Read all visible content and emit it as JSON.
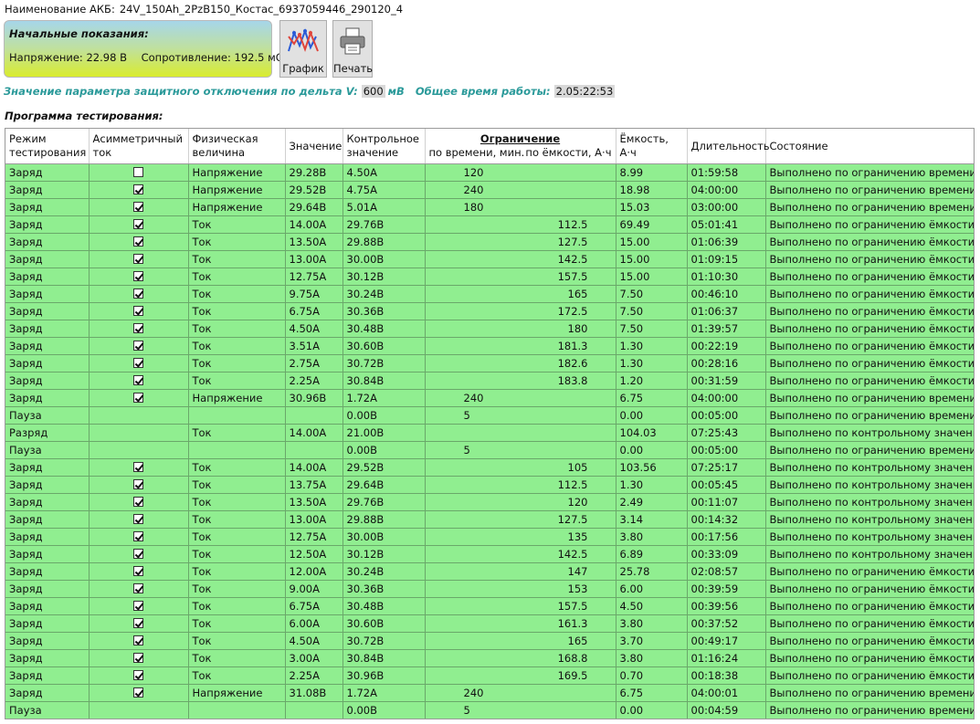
{
  "header": {
    "battery_label": "Наименование АКБ:",
    "battery_name": "24V_150Ah_2PzB150_Костас_6937059446_290120_4"
  },
  "initial": {
    "title": "Начальные показания:",
    "voltage_label": "Напряжение:",
    "voltage_value": "22.98",
    "voltage_unit": "В",
    "resistance_label": "Сопротивление:",
    "resistance_value": "192.5",
    "resistance_unit": "мОм"
  },
  "toolbar": {
    "chart_label": "График",
    "print_label": "Печать"
  },
  "protection": {
    "label": "Значение параметра защитного отключения по дельта V:",
    "value": "600",
    "unit": "мВ",
    "runtime_label": "Общее время работы:",
    "runtime_value": "2.05:22:53"
  },
  "program_title": "Программа тестирования:",
  "columns": {
    "mode": "Режим тестирования",
    "asym": "Асимметричный ток",
    "phys": "Физическая величина",
    "value": "Значение",
    "control": "Контрольное значение",
    "limit": "Ограничение",
    "limit_time": "по времени, мин.",
    "limit_cap": "по ёмкости, А·ч",
    "capacity": "Ёмкость, А·ч",
    "duration": "Длительность",
    "state": "Состояние"
  },
  "colors": {
    "row_bg": "#90ee90",
    "accent": "#2b9a9a"
  },
  "rows": [
    {
      "mode": "Заряд",
      "asym": "unchecked",
      "phys": "Напряжение",
      "value": "29.28В",
      "control": "4.50А",
      "lt": "120",
      "lc": "",
      "cap": "8.99",
      "dur": "01:59:58",
      "state": "Выполнено по ограничению времени"
    },
    {
      "mode": "Заряд",
      "asym": "checked",
      "phys": "Напряжение",
      "value": "29.52В",
      "control": "4.75А",
      "lt": "240",
      "lc": "",
      "cap": "18.98",
      "dur": "04:00:00",
      "state": "Выполнено по ограничению времени"
    },
    {
      "mode": "Заряд",
      "asym": "checked",
      "phys": "Напряжение",
      "value": "29.64В",
      "control": "5.01А",
      "lt": "180",
      "lc": "",
      "cap": "15.03",
      "dur": "03:00:00",
      "state": "Выполнено по ограничению времени"
    },
    {
      "mode": "Заряд",
      "asym": "checked",
      "phys": "Ток",
      "value": "14.00А",
      "control": "29.76В",
      "lt": "",
      "lc": "112.5",
      "cap": "69.49",
      "dur": "05:01:41",
      "state": "Выполнено по ограничению ёмкости"
    },
    {
      "mode": "Заряд",
      "asym": "checked",
      "phys": "Ток",
      "value": "13.50А",
      "control": "29.88В",
      "lt": "",
      "lc": "127.5",
      "cap": "15.00",
      "dur": "01:06:39",
      "state": "Выполнено по ограничению ёмкости"
    },
    {
      "mode": "Заряд",
      "asym": "checked",
      "phys": "Ток",
      "value": "13.00А",
      "control": "30.00В",
      "lt": "",
      "lc": "142.5",
      "cap": "15.00",
      "dur": "01:09:15",
      "state": "Выполнено по ограничению ёмкости"
    },
    {
      "mode": "Заряд",
      "asym": "checked",
      "phys": "Ток",
      "value": "12.75А",
      "control": "30.12В",
      "lt": "",
      "lc": "157.5",
      "cap": "15.00",
      "dur": "01:10:30",
      "state": "Выполнено по ограничению ёмкости"
    },
    {
      "mode": "Заряд",
      "asym": "checked",
      "phys": "Ток",
      "value": "9.75А",
      "control": "30.24В",
      "lt": "",
      "lc": "165",
      "cap": "7.50",
      "dur": "00:46:10",
      "state": "Выполнено по ограничению ёмкости"
    },
    {
      "mode": "Заряд",
      "asym": "checked",
      "phys": "Ток",
      "value": "6.75А",
      "control": "30.36В",
      "lt": "",
      "lc": "172.5",
      "cap": "7.50",
      "dur": "01:06:37",
      "state": "Выполнено по ограничению ёмкости"
    },
    {
      "mode": "Заряд",
      "asym": "checked",
      "phys": "Ток",
      "value": "4.50А",
      "control": "30.48В",
      "lt": "",
      "lc": "180",
      "cap": "7.50",
      "dur": "01:39:57",
      "state": "Выполнено по ограничению ёмкости"
    },
    {
      "mode": "Заряд",
      "asym": "checked",
      "phys": "Ток",
      "value": "3.51А",
      "control": "30.60В",
      "lt": "",
      "lc": "181.3",
      "cap": "1.30",
      "dur": "00:22:19",
      "state": "Выполнено по ограничению ёмкости"
    },
    {
      "mode": "Заряд",
      "asym": "checked",
      "phys": "Ток",
      "value": "2.75А",
      "control": "30.72В",
      "lt": "",
      "lc": "182.6",
      "cap": "1.30",
      "dur": "00:28:16",
      "state": "Выполнено по ограничению ёмкости"
    },
    {
      "mode": "Заряд",
      "asym": "checked",
      "phys": "Ток",
      "value": "2.25А",
      "control": "30.84В",
      "lt": "",
      "lc": "183.8",
      "cap": "1.20",
      "dur": "00:31:59",
      "state": "Выполнено по ограничению ёмкости"
    },
    {
      "mode": "Заряд",
      "asym": "checked",
      "phys": "Напряжение",
      "value": "30.96В",
      "control": "1.72А",
      "lt": "240",
      "lc": "",
      "cap": "6.75",
      "dur": "04:00:00",
      "state": "Выполнено по ограничению времени"
    },
    {
      "mode": "Пауза",
      "asym": "none",
      "phys": "",
      "value": "",
      "control": "0.00В",
      "lt": "5",
      "lc": "",
      "cap": "0.00",
      "dur": "00:05:00",
      "state": "Выполнено по ограничению времени"
    },
    {
      "mode": "Разряд",
      "asym": "none",
      "phys": "Ток",
      "value": "14.00А",
      "control": "21.00В",
      "lt": "",
      "lc": "",
      "cap": "104.03",
      "dur": "07:25:43",
      "state": "Выполнено по контрольному значению"
    },
    {
      "mode": "Пауза",
      "asym": "none",
      "phys": "",
      "value": "",
      "control": "0.00В",
      "lt": "5",
      "lc": "",
      "cap": "0.00",
      "dur": "00:05:00",
      "state": "Выполнено по ограничению времени"
    },
    {
      "mode": "Заряд",
      "asym": "checked",
      "phys": "Ток",
      "value": "14.00А",
      "control": "29.52В",
      "lt": "",
      "lc": "105",
      "cap": "103.56",
      "dur": "07:25:17",
      "state": "Выполнено по контрольному значению"
    },
    {
      "mode": "Заряд",
      "asym": "checked",
      "phys": "Ток",
      "value": "13.75А",
      "control": "29.64В",
      "lt": "",
      "lc": "112.5",
      "cap": "1.30",
      "dur": "00:05:45",
      "state": "Выполнено по контрольному значению"
    },
    {
      "mode": "Заряд",
      "asym": "checked",
      "phys": "Ток",
      "value": "13.50А",
      "control": "29.76В",
      "lt": "",
      "lc": "120",
      "cap": "2.49",
      "dur": "00:11:07",
      "state": "Выполнено по контрольному значению"
    },
    {
      "mode": "Заряд",
      "asym": "checked",
      "phys": "Ток",
      "value": "13.00А",
      "control": "29.88В",
      "lt": "",
      "lc": "127.5",
      "cap": "3.14",
      "dur": "00:14:32",
      "state": "Выполнено по контрольному значению"
    },
    {
      "mode": "Заряд",
      "asym": "checked",
      "phys": "Ток",
      "value": "12.75А",
      "control": "30.00В",
      "lt": "",
      "lc": "135",
      "cap": "3.80",
      "dur": "00:17:56",
      "state": "Выполнено по контрольному значению"
    },
    {
      "mode": "Заряд",
      "asym": "checked",
      "phys": "Ток",
      "value": "12.50А",
      "control": "30.12В",
      "lt": "",
      "lc": "142.5",
      "cap": "6.89",
      "dur": "00:33:09",
      "state": "Выполнено по контрольному значению"
    },
    {
      "mode": "Заряд",
      "asym": "checked",
      "phys": "Ток",
      "value": "12.00А",
      "control": "30.24В",
      "lt": "",
      "lc": "147",
      "cap": "25.78",
      "dur": "02:08:57",
      "state": "Выполнено по ограничению ёмкости"
    },
    {
      "mode": "Заряд",
      "asym": "checked",
      "phys": "Ток",
      "value": "9.00А",
      "control": "30.36В",
      "lt": "",
      "lc": "153",
      "cap": "6.00",
      "dur": "00:39:59",
      "state": "Выполнено по ограничению ёмкости"
    },
    {
      "mode": "Заряд",
      "asym": "checked",
      "phys": "Ток",
      "value": "6.75А",
      "control": "30.48В",
      "lt": "",
      "lc": "157.5",
      "cap": "4.50",
      "dur": "00:39:56",
      "state": "Выполнено по ограничению ёмкости"
    },
    {
      "mode": "Заряд",
      "asym": "checked",
      "phys": "Ток",
      "value": "6.00А",
      "control": "30.60В",
      "lt": "",
      "lc": "161.3",
      "cap": "3.80",
      "dur": "00:37:52",
      "state": "Выполнено по ограничению ёмкости"
    },
    {
      "mode": "Заряд",
      "asym": "checked",
      "phys": "Ток",
      "value": "4.50А",
      "control": "30.72В",
      "lt": "",
      "lc": "165",
      "cap": "3.70",
      "dur": "00:49:17",
      "state": "Выполнено по ограничению ёмкости"
    },
    {
      "mode": "Заряд",
      "asym": "checked",
      "phys": "Ток",
      "value": "3.00А",
      "control": "30.84В",
      "lt": "",
      "lc": "168.8",
      "cap": "3.80",
      "dur": "01:16:24",
      "state": "Выполнено по ограничению ёмкости"
    },
    {
      "mode": "Заряд",
      "asym": "checked",
      "phys": "Ток",
      "value": "2.25А",
      "control": "30.96В",
      "lt": "",
      "lc": "169.5",
      "cap": "0.70",
      "dur": "00:18:38",
      "state": "Выполнено по ограничению ёмкости"
    },
    {
      "mode": "Заряд",
      "asym": "checked",
      "phys": "Напряжение",
      "value": "31.08В",
      "control": "1.72А",
      "lt": "240",
      "lc": "",
      "cap": "6.75",
      "dur": "04:00:01",
      "state": "Выполнено по ограничению времени"
    },
    {
      "mode": "Пауза",
      "asym": "none",
      "phys": "",
      "value": "",
      "control": "0.00В",
      "lt": "5",
      "lc": "",
      "cap": "0.00",
      "dur": "00:04:59",
      "state": "Выполнено по ограничению времени"
    }
  ]
}
